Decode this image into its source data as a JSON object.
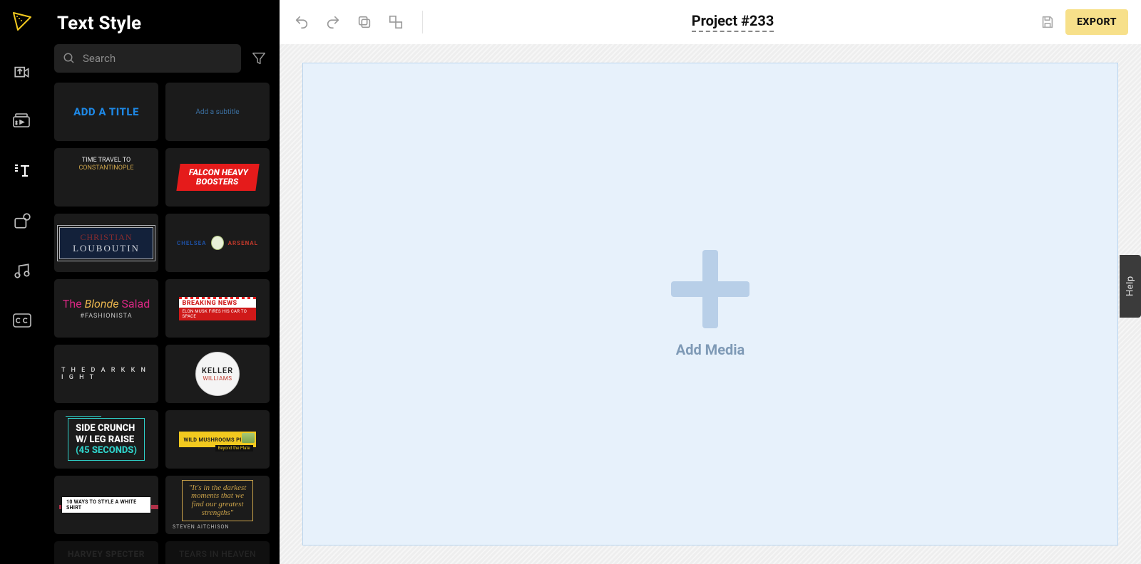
{
  "panel": {
    "title": "Text Style",
    "search_placeholder": "Search"
  },
  "rail": {
    "items": [
      "upload",
      "media",
      "text-style",
      "elements",
      "audio",
      "captions"
    ]
  },
  "topbar": {
    "project_name": "Project #233",
    "export_label": "EXPORT"
  },
  "canvas": {
    "add_media_label": "Add Media"
  },
  "help_label": "Help",
  "thumbs": {
    "t0": "ADD A TITLE",
    "t1": "Add a subtitle",
    "t2a": "TIME TRAVEL TO",
    "t2b": "CONSTANTINOPLE",
    "t3a": "FALCON HEAVY",
    "t3b": "BOOSTERS",
    "t4a": "CHRISTIAN",
    "t4b": "LOUBOUTIN",
    "t5a": "CHELSEA",
    "t5b": "ARSENAL",
    "t6a": "The ",
    "t6em": "Blonde",
    "t6c": " Salad",
    "t6d": "#FASHIONISTA",
    "t7a": "BREAKING NEWS",
    "t7b": "ELON MUSK FIRES HIS CAR TO SPACE",
    "t8": "T H E   D A R K   K N I G H T",
    "t9a": "KELLER",
    "t9b": "WILLIAMS",
    "t10a": "SIDE CRUNCH",
    "t10b": "W/ LEG RAISE",
    "t10c": "(45 SECONDS)",
    "t11a": "WILD MUSHROOMS PIZZA",
    "t11b": "Beyond the Plate",
    "t12": "10 WAYS TO STYLE A WHITE SHIRT",
    "t13": "\"It's in the darkest moments that we find our greatest strengths\"",
    "t13b": "STEVEN AITCHISON",
    "t14": "HARVEY SPECTER",
    "t15": "TEARS IN HEAVEN"
  }
}
